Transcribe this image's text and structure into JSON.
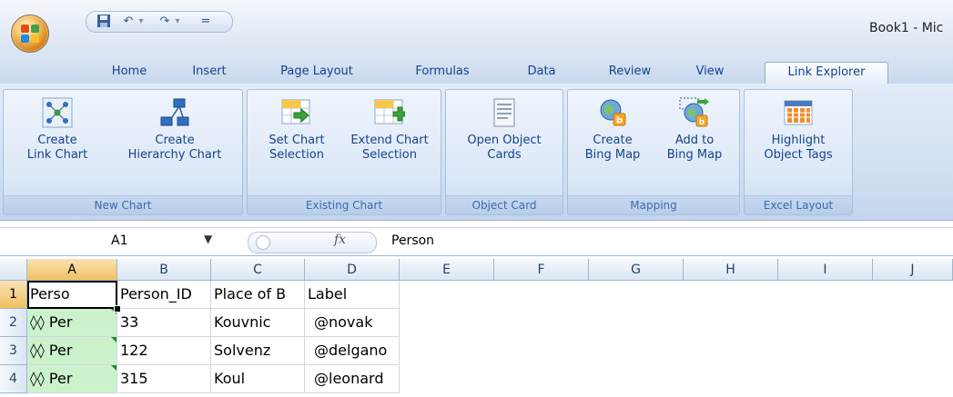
{
  "window": {
    "title": "Book1 - Mic"
  },
  "quick_access": {
    "save_icon": "floppy-disk-icon",
    "undo_icon": "undo-arrow-icon",
    "redo_icon": "redo-arrow-icon",
    "arrow": "▾",
    "customize": "="
  },
  "tabs": [
    {
      "label": "Home"
    },
    {
      "label": "Insert"
    },
    {
      "label": "Page Layout"
    },
    {
      "label": "Formulas"
    },
    {
      "label": "Data"
    },
    {
      "label": "Review"
    },
    {
      "label": "View"
    },
    {
      "label": "Link Explorer",
      "active": true
    }
  ],
  "ribbon": {
    "groups": [
      {
        "label": "New Chart",
        "buttons": [
          {
            "line1": "Create",
            "line2": "Link Chart",
            "icon": "link-chart-icon"
          },
          {
            "line1": "Create",
            "line2": "Hierarchy Chart",
            "icon": "hierarchy-chart-icon"
          }
        ]
      },
      {
        "label": "Existing Chart",
        "buttons": [
          {
            "line1": "Set Chart",
            "line2": "Selection",
            "icon": "set-chart-selection-icon"
          },
          {
            "line1": "Extend Chart",
            "line2": "Selection",
            "icon": "extend-chart-selection-icon"
          }
        ]
      },
      {
        "label": "Object Card",
        "buttons": [
          {
            "line1": "Open Object",
            "line2": "Cards",
            "icon": "object-card-icon"
          }
        ]
      },
      {
        "label": "Mapping",
        "buttons": [
          {
            "line1": "Create",
            "line2": "Bing Map",
            "icon": "bing-map-icon"
          },
          {
            "line1": "Add to",
            "line2": "Bing Map",
            "icon": "add-to-bing-map-icon"
          }
        ]
      },
      {
        "label": "Excel Layout",
        "buttons": [
          {
            "line1": "Highlight",
            "line2": "Object Tags",
            "icon": "highlight-tags-icon"
          }
        ]
      }
    ]
  },
  "formula_bar": {
    "name_box": "A1",
    "dropdown": "▼",
    "fx": "fx",
    "value": "Person"
  },
  "sheet": {
    "columns": [
      "A",
      "B",
      "C",
      "D",
      "E",
      "F",
      "G",
      "H",
      "I",
      "J"
    ],
    "rows": [
      {
        "num": "1",
        "cells": [
          "Perso",
          "Person_ID",
          "Place of B",
          "Label"
        ]
      },
      {
        "num": "2",
        "cells": [
          "◊◊ Per",
          "33",
          "Kouvnic",
          "@novak"
        ]
      },
      {
        "num": "3",
        "cells": [
          "◊◊ Per",
          "122",
          "Solvenz",
          "@delgano"
        ]
      },
      {
        "num": "4",
        "cells": [
          "◊◊ Per",
          "315",
          "Koul",
          "@leonard"
        ]
      }
    ],
    "accent_colors": {
      "selected_header": "#f1c15f",
      "green_cell": "#ccf2cc",
      "tab_text": "#15428b"
    }
  }
}
